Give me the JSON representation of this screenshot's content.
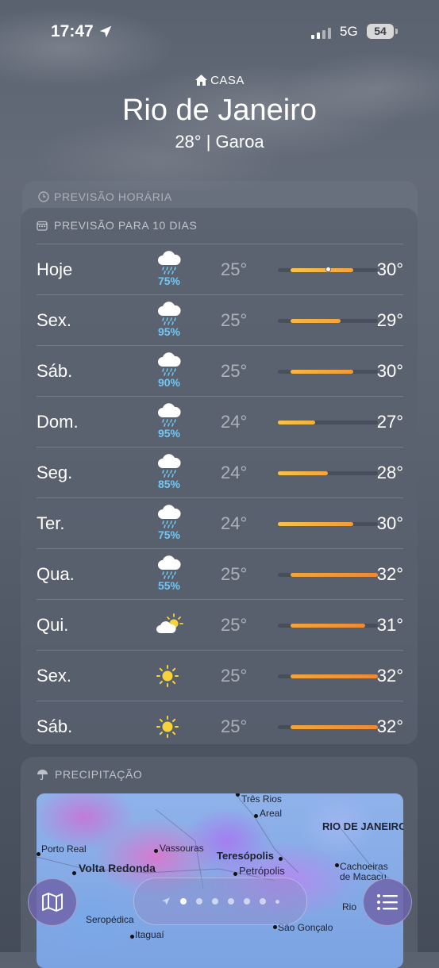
{
  "status_bar": {
    "time": "17:47",
    "network": "5G",
    "battery": "54"
  },
  "header": {
    "home_label": "CASA",
    "city": "Rio de Janeiro",
    "current": "28°  |  Garoa"
  },
  "hourly": {
    "label": "PREVISÃO HORÁRIA"
  },
  "forecast": {
    "label": "PREVISÃO PARA 10 DIAS",
    "range_min": 24,
    "range_max": 32,
    "current_temp_marker": 28,
    "days": [
      {
        "day": "Hoje",
        "icon": "rain-cloud-icon",
        "pct": "75%",
        "low": "25°",
        "high": "30°",
        "lo": 25,
        "hi": 30,
        "color_from": "#f6c44a",
        "color_to": "#f3a43a"
      },
      {
        "day": "Sex.",
        "icon": "rain-cloud-icon",
        "pct": "95%",
        "low": "25°",
        "high": "29°",
        "lo": 25,
        "hi": 29,
        "color_from": "#f6b745",
        "color_to": "#f3a43a"
      },
      {
        "day": "Sáb.",
        "icon": "rain-cloud-icon",
        "pct": "90%",
        "low": "25°",
        "high": "30°",
        "lo": 25,
        "hi": 30,
        "color_from": "#f6b745",
        "color_to": "#f29a38"
      },
      {
        "day": "Dom.",
        "icon": "rain-cloud-icon",
        "pct": "95%",
        "low": "24°",
        "high": "27°",
        "lo": 24,
        "hi": 27,
        "color_from": "#f6c44a",
        "color_to": "#f3b040"
      },
      {
        "day": "Seg.",
        "icon": "rain-cloud-icon",
        "pct": "85%",
        "low": "24°",
        "high": "28°",
        "lo": 24,
        "hi": 28,
        "color_from": "#f6c44a",
        "color_to": "#f3a43a"
      },
      {
        "day": "Ter.",
        "icon": "rain-cloud-icon",
        "pct": "75%",
        "low": "24°",
        "high": "30°",
        "lo": 24,
        "hi": 30,
        "color_from": "#f6c44a",
        "color_to": "#f29a38"
      },
      {
        "day": "Qua.",
        "icon": "rain-cloud-icon",
        "pct": "55%",
        "low": "25°",
        "high": "32°",
        "lo": 25,
        "hi": 32,
        "color_from": "#f3a43a",
        "color_to": "#ee8a36"
      },
      {
        "day": "Qui.",
        "icon": "partly-cloudy-icon",
        "pct": "",
        "low": "25°",
        "high": "31°",
        "lo": 25,
        "hi": 31,
        "color_from": "#f3a43a",
        "color_to": "#ee8a36"
      },
      {
        "day": "Sex.",
        "icon": "sun-icon",
        "pct": "",
        "low": "25°",
        "high": "32°",
        "lo": 25,
        "hi": 32,
        "color_from": "#f3a43a",
        "color_to": "#ee8a36"
      },
      {
        "day": "Sáb.",
        "icon": "sun-icon",
        "pct": "",
        "low": "25°",
        "high": "32°",
        "lo": 25,
        "hi": 32,
        "color_from": "#f3a43a",
        "color_to": "#ee8a36"
      }
    ]
  },
  "precipitation": {
    "label": "PRECIPITAÇÃO",
    "map_labels": [
      "Três Rios",
      "Areal",
      "RIO DE JANEIRO",
      "Porto Real",
      "Vassouras",
      "Volta Redonda",
      "Teresópolis",
      "Petrópolis",
      "Cachoeiras de Macacu",
      "Seropédica",
      "Itaguaí",
      "São Gonçalo",
      "Rio"
    ]
  },
  "bottom_bar": {
    "pages": 7,
    "active_page": 1
  }
}
